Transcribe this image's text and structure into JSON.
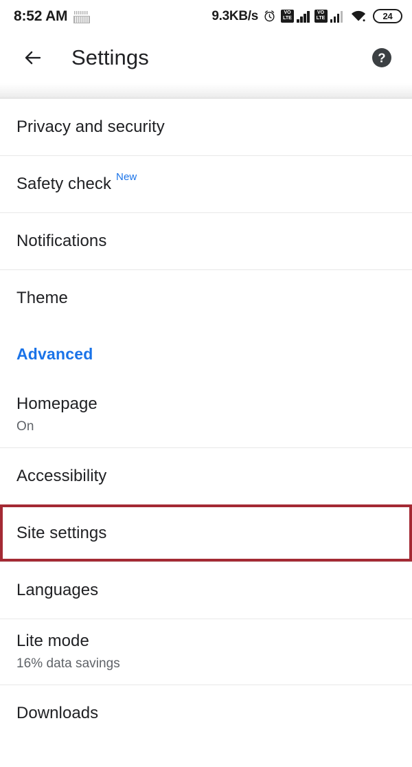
{
  "status_bar": {
    "time": "8:52 AM",
    "notification_icon": "keyboard-notification-icon",
    "network_speed": "9.3KB/s",
    "alarm_icon": "alarm-clock-icon",
    "sim1_volte_line1": "VO",
    "sim1_volte_line2": "LTE",
    "sim2_volte_line1": "VO",
    "sim2_volte_line2": "LTE",
    "wifi_icon": "wifi-icon",
    "battery_level": "24"
  },
  "toolbar": {
    "back_icon": "back-arrow-icon",
    "title": "Settings",
    "help_icon": "help-circle-icon"
  },
  "colors": {
    "accent_blue": "#1a73e8",
    "highlight_red": "#a42a34",
    "text_primary": "#202124",
    "text_secondary": "#5f6368",
    "divider": "#e8e8e8",
    "background": "#ffffff"
  },
  "settings": {
    "items": [
      {
        "id": "privacy-and-security",
        "title": "Privacy and security",
        "subtitle": null,
        "badge": null,
        "type": "row",
        "divider_above": true,
        "highlighted": false
      },
      {
        "id": "safety-check",
        "title": "Safety check",
        "subtitle": null,
        "badge": "New",
        "type": "row",
        "divider_above": true,
        "highlighted": false
      },
      {
        "id": "notifications",
        "title": "Notifications",
        "subtitle": null,
        "badge": null,
        "type": "row",
        "divider_above": true,
        "highlighted": false
      },
      {
        "id": "theme",
        "title": "Theme",
        "subtitle": null,
        "badge": null,
        "type": "row",
        "divider_above": true,
        "highlighted": false
      },
      {
        "id": "advanced",
        "title": "Advanced",
        "subtitle": null,
        "badge": null,
        "type": "section-header",
        "divider_above": false,
        "highlighted": false
      },
      {
        "id": "homepage",
        "title": "Homepage",
        "subtitle": "On",
        "badge": null,
        "type": "row",
        "divider_above": false,
        "highlighted": false
      },
      {
        "id": "accessibility",
        "title": "Accessibility",
        "subtitle": null,
        "badge": null,
        "type": "row",
        "divider_above": true,
        "highlighted": false
      },
      {
        "id": "site-settings",
        "title": "Site settings",
        "subtitle": null,
        "badge": null,
        "type": "row",
        "divider_above": true,
        "highlighted": true
      },
      {
        "id": "languages",
        "title": "Languages",
        "subtitle": null,
        "badge": null,
        "type": "row",
        "divider_above": true,
        "highlighted": false
      },
      {
        "id": "lite-mode",
        "title": "Lite mode",
        "subtitle": "16% data savings",
        "badge": null,
        "type": "row",
        "divider_above": true,
        "highlighted": false
      },
      {
        "id": "downloads",
        "title": "Downloads",
        "subtitle": null,
        "badge": null,
        "type": "row",
        "divider_above": true,
        "highlighted": false
      }
    ]
  }
}
